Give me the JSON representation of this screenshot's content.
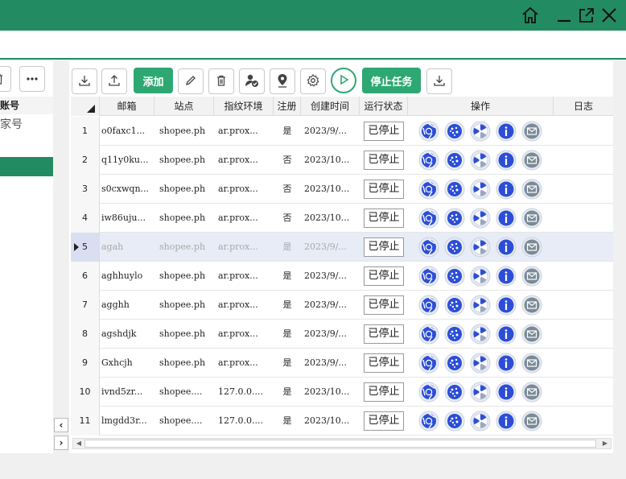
{
  "toolbar": {
    "add_label": "添加",
    "stop_label": "停止任务"
  },
  "left_panel": {
    "header": "账号",
    "cell": "家号"
  },
  "columns": [
    "邮箱",
    "站点",
    "指纹环境",
    "注册",
    "创建时间",
    "运行状态",
    "操作",
    "日志"
  ],
  "rows": [
    {
      "n": "1",
      "email": "o0faxc1...",
      "site": "shopee.ph",
      "env": "ar.prox...",
      "reg": "是",
      "created": "2023/9/...",
      "status": "已停止"
    },
    {
      "n": "2",
      "email": "q11y0ku...",
      "site": "shopee.ph",
      "env": "ar.prox...",
      "reg": "否",
      "created": "2023/10...",
      "status": "已停止"
    },
    {
      "n": "3",
      "email": "s0cxwqn...",
      "site": "shopee.ph",
      "env": "ar.prox...",
      "reg": "否",
      "created": "2023/10...",
      "status": "已停止"
    },
    {
      "n": "4",
      "email": "iw86uju...",
      "site": "shopee.ph",
      "env": "ar.prox...",
      "reg": "否",
      "created": "2023/10...",
      "status": "已停止"
    },
    {
      "n": "5",
      "email": "agah",
      "site": "shopee.ph",
      "env": "ar.prox...",
      "reg": "是",
      "created": "2023/9/...",
      "status": "已停止"
    },
    {
      "n": "6",
      "email": "aghhuylo",
      "site": "shopee.ph",
      "env": "ar.prox...",
      "reg": "是",
      "created": "2023/9/...",
      "status": "已停止"
    },
    {
      "n": "7",
      "email": "agghh",
      "site": "shopee.ph",
      "env": "ar.prox...",
      "reg": "是",
      "created": "2023/9/...",
      "status": "已停止"
    },
    {
      "n": "8",
      "email": "agshdjk",
      "site": "shopee.ph",
      "env": "ar.prox...",
      "reg": "是",
      "created": "2023/9/...",
      "status": "已停止"
    },
    {
      "n": "9",
      "email": "Gxhcjh",
      "site": "shopee.ph",
      "env": "ar.prox...",
      "reg": "是",
      "created": "2023/9/...",
      "status": "已停止"
    },
    {
      "n": "10",
      "email": "ivnd5zr...",
      "site": "shopee....",
      "env": "127.0.0....",
      "reg": "是",
      "created": "2023/10...",
      "status": "已停止"
    },
    {
      "n": "11",
      "email": "lmgdd3r...",
      "site": "shopee....",
      "env": "127.0.0....",
      "reg": "是",
      "created": "2023/10...",
      "status": "已停止"
    }
  ],
  "selected_row": 5,
  "colors": {
    "brand": "#238b62",
    "button_green": "#2ea872",
    "action_blue": "#2c4ed6",
    "action_gray": "#7a8a96"
  },
  "icons": [
    "home-icon",
    "minimize-icon",
    "external-link-icon",
    "close-icon",
    "download-icon",
    "upload-icon",
    "edit-icon",
    "trash-icon",
    "user-check-icon",
    "location-pin-icon",
    "settings-icon",
    "play-icon",
    "chrome-icon",
    "cookie-icon",
    "fan-icon",
    "info-icon",
    "mail-icon"
  ]
}
